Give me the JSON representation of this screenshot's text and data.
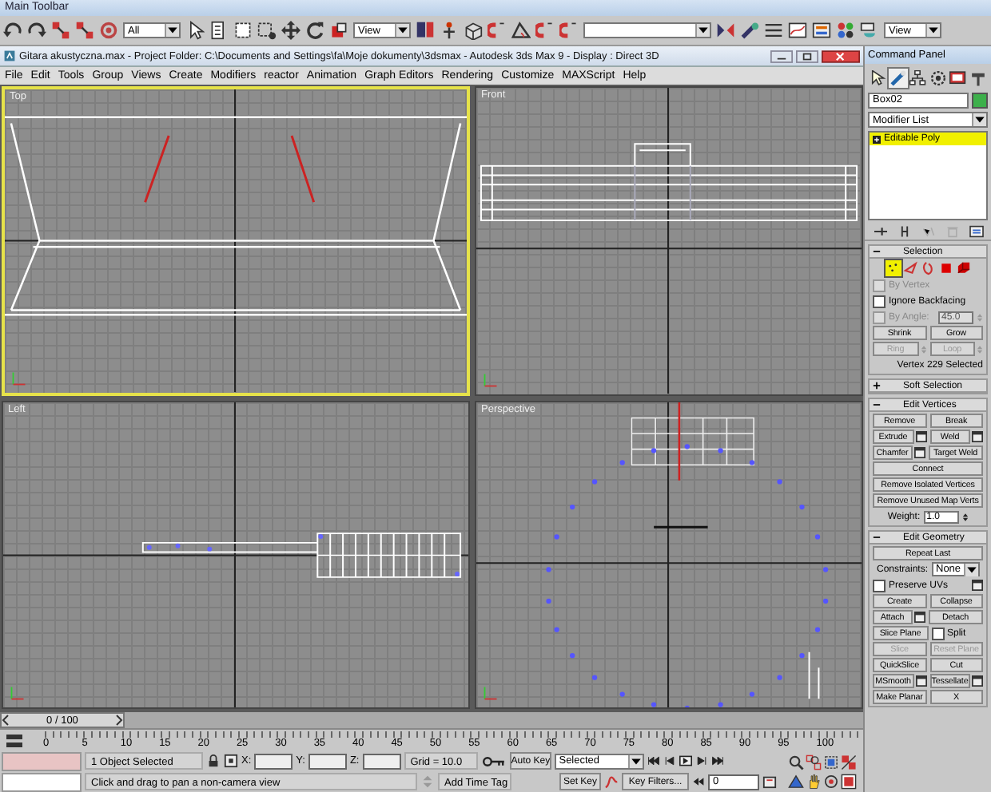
{
  "main_toolbar": {
    "title": "Main Toolbar",
    "selection_filter": "All",
    "reference_coord": "View",
    "render_preset": "View"
  },
  "window": {
    "title": "Gitara akustyczna.max   - Project Folder: C:\\Documents and Settings\\fa\\Moje dokumenty\\3dsmax   - Autodesk 3ds Max 9   - Display : Direct 3D"
  },
  "menu": [
    "File",
    "Edit",
    "Tools",
    "Group",
    "Views",
    "Create",
    "Modifiers",
    "reactor",
    "Animation",
    "Graph Editors",
    "Rendering",
    "Customize",
    "MAXScript",
    "Help"
  ],
  "viewports": [
    {
      "label": "Top",
      "selected": true
    },
    {
      "label": "Front",
      "selected": false
    },
    {
      "label": "Left",
      "selected": false
    },
    {
      "label": "Perspective",
      "selected": false
    }
  ],
  "command_panel": {
    "title": "Command Panel",
    "tabs": [
      {
        "selected": false
      },
      {
        "selected": true
      },
      {
        "selected": false
      },
      {
        "selected": false
      },
      {
        "selected": false
      },
      {
        "selected": false
      }
    ],
    "object_name": "Box02",
    "modifier_list": "Modifier List",
    "stack": [
      {
        "label": "Editable Poly",
        "selected": true
      }
    ],
    "rollouts": [
      {
        "title": "Selection",
        "expanded": true,
        "rows": [
          [
            {
              "kind": "subobjects",
              "levels": [
                {
                  "selected": true
                },
                {
                  "selected": false
                },
                {
                  "selected": false
                },
                {
                  "selected": false
                },
                {
                  "selected": false
                }
              ]
            }
          ],
          [
            {
              "kind": "checkbox",
              "label": "By Vertex",
              "checked": false,
              "disabled": true
            }
          ],
          [
            {
              "kind": "checkbox",
              "label": "Ignore Backfacing",
              "checked": false,
              "disabled": false
            }
          ],
          [
            {
              "kind": "checkbox",
              "label": "By Angle:",
              "checked": false,
              "disabled": true
            },
            {
              "kind": "spinner",
              "value": "45.0",
              "disabled": true
            }
          ],
          [
            {
              "kind": "button",
              "label": "Shrink",
              "disabled": false
            },
            {
              "kind": "button",
              "label": "Grow",
              "disabled": false
            }
          ],
          [
            {
              "kind": "spin_button",
              "label": "Ring",
              "disabled": true
            },
            {
              "kind": "spin_button",
              "label": "Loop",
              "disabled": true
            }
          ],
          [
            {
              "kind": "text",
              "label": "Vertex 229 Selected"
            }
          ]
        ]
      },
      {
        "title": "Soft Selection",
        "expanded": false
      },
      {
        "title": "Edit Vertices",
        "expanded": true,
        "rows": [
          [
            {
              "kind": "button",
              "label": "Remove",
              "disabled": false
            },
            {
              "kind": "button",
              "label": "Break",
              "disabled": false
            }
          ],
          [
            {
              "kind": "settings_button",
              "label": "Extrude",
              "disabled": false
            },
            {
              "kind": "settings_button",
              "label": "Weld",
              "disabled": false
            }
          ],
          [
            {
              "kind": "settings_button",
              "label": "Chamfer",
              "disabled": false
            },
            {
              "kind": "button",
              "label": "Target Weld",
              "disabled": false
            }
          ],
          [
            {
              "kind": "button",
              "label": "Connect",
              "disabled": false
            }
          ],
          [
            {
              "kind": "button",
              "label": "Remove Isolated Vertices",
              "disabled": false
            }
          ],
          [
            {
              "kind": "button",
              "label": "Remove Unused Map Verts",
              "disabled": false
            }
          ],
          [
            {
              "kind": "spinner",
              "label": "Weight:",
              "value": "1.0",
              "disabled": false
            }
          ]
        ]
      },
      {
        "title": "Edit Geometry",
        "expanded": true,
        "rows": [
          [
            {
              "kind": "button",
              "label": "Repeat Last",
              "disabled": false
            }
          ],
          [
            {
              "kind": "dropdown",
              "label": "Constraints:",
              "value": "None"
            }
          ],
          [
            {
              "kind": "checkbox",
              "label": "Preserve UVs",
              "checked": false,
              "disabled": false
            },
            {
              "kind": "settings_icon"
            }
          ],
          [
            {
              "kind": "button",
              "label": "Create",
              "disabled": false
            },
            {
              "kind": "button",
              "label": "Collapse",
              "disabled": false
            }
          ],
          [
            {
              "kind": "settings_button",
              "label": "Attach",
              "disabled": false
            },
            {
              "kind": "button",
              "label": "Detach",
              "disabled": false
            }
          ],
          [
            {
              "kind": "button",
              "label": "Slice Plane",
              "disabled": false
            },
            {
              "kind": "checkbox",
              "label": "Split",
              "checked": false,
              "disabled": false
            }
          ],
          [
            {
              "kind": "button",
              "label": "Slice",
              "disabled": true
            },
            {
              "kind": "button",
              "label": "Reset Plane",
              "disabled": true
            }
          ],
          [
            {
              "kind": "button",
              "label": "QuickSlice",
              "disabled": false
            },
            {
              "kind": "button",
              "label": "Cut",
              "disabled": false
            }
          ],
          [
            {
              "kind": "settings_button",
              "label": "MSmooth",
              "disabled": false
            },
            {
              "kind": "settings_button",
              "label": "Tessellate",
              "disabled": false
            }
          ],
          [
            {
              "kind": "button",
              "label": "Make Planar",
              "disabled": false
            },
            {
              "kind": "button",
              "label": "X",
              "disabled": false
            }
          ]
        ]
      }
    ]
  },
  "timeline": {
    "slider_label": "0 / 100",
    "level": 0,
    "ticks": [
      "0",
      "5",
      "10",
      "15",
      "20",
      "25",
      "30",
      "35",
      "40",
      "45",
      "50",
      "55",
      "60",
      "65",
      "70",
      "75",
      "80",
      "85",
      "90",
      "95",
      "100"
    ]
  },
  "status_bar": {
    "selection": "1 Object Selected",
    "coords": [
      "X:",
      "Y:",
      "Z:"
    ],
    "grid": "Grid = 10.0",
    "prompt": "Click and drag to pan a non-camera view",
    "time_tag": "Add Time Tag",
    "auto_key": "Auto Key",
    "key_set": "Selected",
    "set_key": "Set Key",
    "key_filters": "Key Filters...",
    "current_frame": "0"
  }
}
